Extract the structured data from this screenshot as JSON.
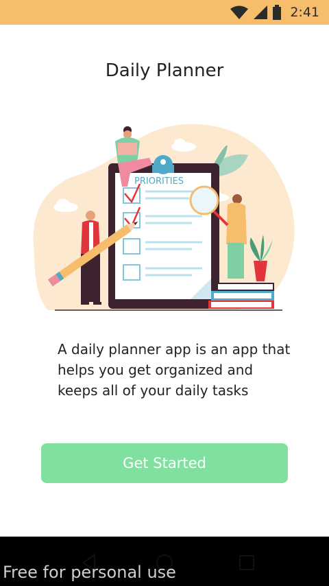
{
  "status_bar": {
    "time": "2:41",
    "icons": [
      "wifi-icon",
      "signal-icon",
      "battery-icon"
    ]
  },
  "app": {
    "title": "Daily Planner"
  },
  "illustration": {
    "clipboard_heading": "PRIORITIES"
  },
  "description": "A daily planner app is an app that helps you get organized and keeps all of your daily tasks",
  "cta": {
    "label": "Get Started"
  },
  "nav": {
    "items": [
      "back-icon",
      "home-icon",
      "recents-icon"
    ]
  },
  "watermark": "Free for personal use",
  "colors": {
    "status_bar": "#f6bd6c",
    "button": "#80e0a0",
    "accent_blue": "#4fa9c9",
    "check_red": "#e2343b"
  }
}
